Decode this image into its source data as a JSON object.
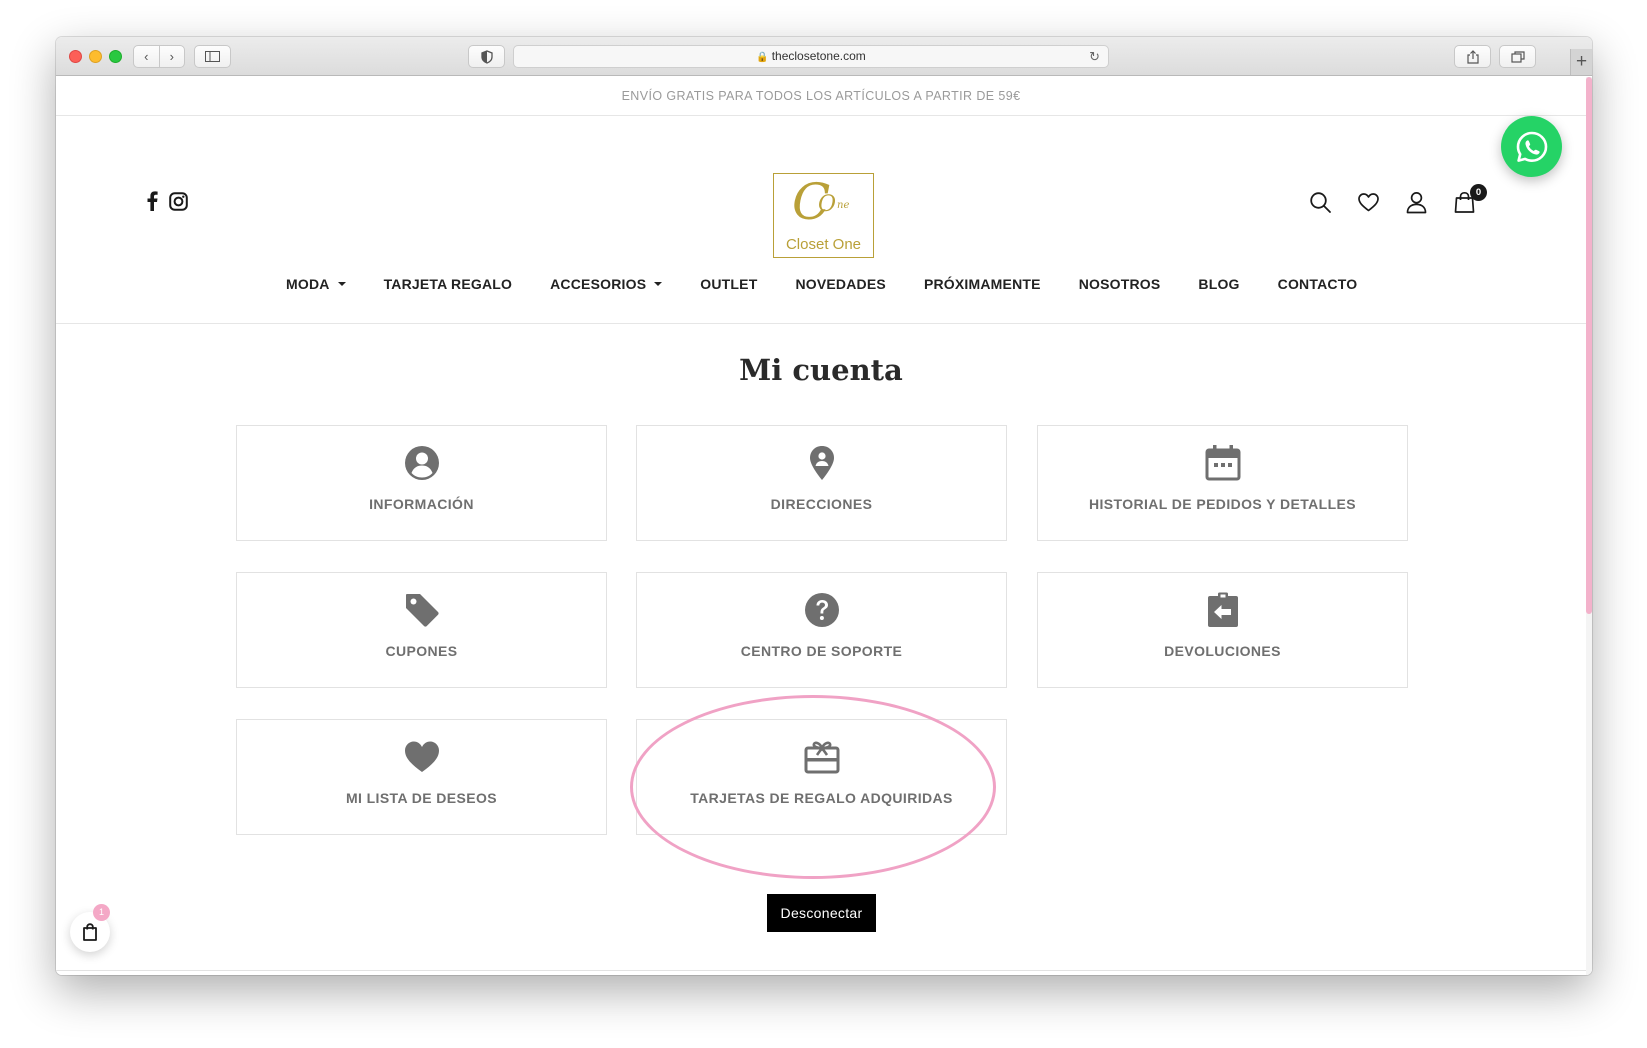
{
  "browser": {
    "url": "theclosetone.com",
    "icons": {
      "back": "chevron-left-icon",
      "forward": "chevron-right-icon",
      "sidebar": "sidebar-icon",
      "privacy": "shield-icon",
      "reload": "reload-icon",
      "share": "share-icon",
      "tabs": "tabs-icon",
      "new_tab": "plus-icon"
    }
  },
  "topbar": {
    "text": "ENVÍO GRATIS PARA TODOS LOS ARTÍCULOS A PARTIR DE 59€"
  },
  "header": {
    "logo": {
      "text": "Closet One",
      "mark_c": "C",
      "mark_o": "O",
      "mark_ne": "ne",
      "color": "#b9a038"
    },
    "social": [
      "facebook-icon",
      "instagram-icon"
    ],
    "icons": [
      "search-icon",
      "heart-icon",
      "user-icon",
      "cart-icon"
    ],
    "cart_count": "0"
  },
  "nav": {
    "items": [
      {
        "label": "MODA",
        "dropdown": true
      },
      {
        "label": "TARJETA REGALO",
        "dropdown": false
      },
      {
        "label": "ACCESORIOS",
        "dropdown": true
      },
      {
        "label": "OUTLET",
        "dropdown": false
      },
      {
        "label": "NOVEDADES",
        "dropdown": false
      },
      {
        "label": "PRÓXIMAMENTE",
        "dropdown": false
      },
      {
        "label": "NOSOTROS",
        "dropdown": false
      },
      {
        "label": "BLOG",
        "dropdown": false
      },
      {
        "label": "CONTACTO",
        "dropdown": false
      }
    ]
  },
  "account": {
    "title": "Mi cuenta",
    "tiles": [
      {
        "label": "INFORMACIÓN",
        "icon": "user-circle-icon"
      },
      {
        "label": "DIRECCIONES",
        "icon": "location-pin-icon"
      },
      {
        "label": "HISTORIAL DE PEDIDOS Y DETALLES",
        "icon": "calendar-icon"
      },
      {
        "label": "CUPONES",
        "icon": "tag-icon"
      },
      {
        "label": "CENTRO DE SOPORTE",
        "icon": "help-circle-icon"
      },
      {
        "label": "DEVOLUCIONES",
        "icon": "return-clipboard-icon"
      },
      {
        "label": "MI LISTA DE DESEOS",
        "icon": "heart-icon"
      },
      {
        "label": "TARJETAS DE REGALO ADQUIRIDAS",
        "icon": "gift-card-icon"
      }
    ],
    "highlighted_tile": "TARJETAS DE REGALO ADQUIRIDAS",
    "logout_label": "Desconectar"
  },
  "floating": {
    "cart_badge": "1",
    "whatsapp_icon": "whatsapp-icon"
  },
  "colors": {
    "accent_pink": "#f0a2c5",
    "whatsapp_green": "#25d366",
    "icon_gray": "#6f6f6f",
    "gold": "#b9a038"
  }
}
